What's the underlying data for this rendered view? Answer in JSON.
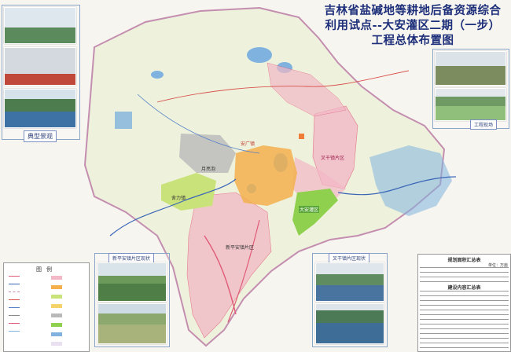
{
  "title_lines": [
    "吉林省盐碱地等耕地后备资源综合",
    "利用试点--大安灌区二期（一步）",
    "工程总体布置图"
  ],
  "captions": {
    "left_photos": "典型景观",
    "right_photos": "工程现场",
    "bottom_left": "新平安镇片区现状",
    "bottom_right": "叉干镇片区现状"
  },
  "map_labels": {
    "district_east": "叉干镇片区",
    "district_center": "安广镇",
    "district_south": "新平安镇片区",
    "district_west": "舍力镇",
    "lake_label": "月亮泡",
    "east_area": "大安灌区"
  },
  "legend": {
    "title": "图例"
  },
  "summary_table": {
    "title": "规划面积汇总表",
    "title2": "建设内容汇总表",
    "unit": "单位：万亩"
  },
  "colors": {
    "water": "#7fb2de",
    "river": "#3b66b8",
    "irrigation_pink": "#f2b8c6",
    "canal_red": "#e05a78",
    "green_zone": "#c9e27a",
    "orange_zone": "#f3b04d",
    "gray_zone": "#b9b9b9",
    "road": "#d9534f"
  }
}
